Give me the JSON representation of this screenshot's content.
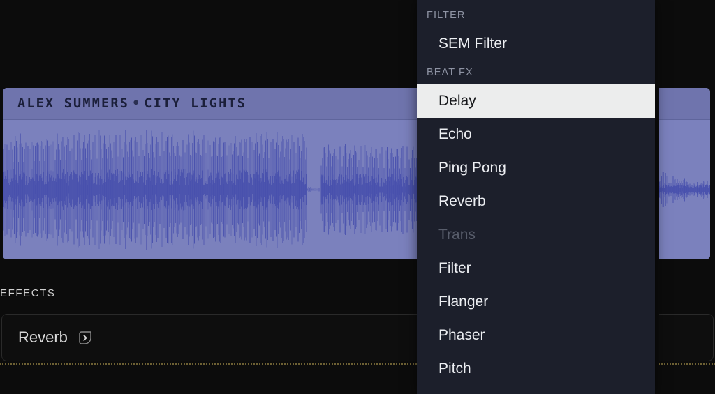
{
  "theme": {
    "page_bg": "#0c0c0c",
    "waveform_bg": "#7b81bd",
    "waveform_ink": "#4850ad",
    "track_header_bg": "#6f74ad",
    "menu_bg": "#1c1f2b",
    "menu_selected_bg": "#eceded",
    "menu_selected_text": "#16171a",
    "menu_label_text": "#8e93a3",
    "menu_disabled_text": "#585d6b",
    "divider_dotted": "#6d6033"
  },
  "track": {
    "artist": "ALEX SUMMERS",
    "separator": "•",
    "title": "CITY LIGHTS"
  },
  "effects": {
    "section_label": "EFFECTS",
    "items": [
      {
        "name": "Reverb",
        "expand_icon": "chevron-right-icon"
      }
    ]
  },
  "menu": {
    "sections": [
      {
        "label": "FILTER",
        "items": [
          {
            "label": "SEM Filter",
            "state": "normal"
          }
        ]
      },
      {
        "label": "BEAT FX",
        "items": [
          {
            "label": "Delay",
            "state": "selected"
          },
          {
            "label": "Echo",
            "state": "normal"
          },
          {
            "label": "Ping Pong",
            "state": "normal"
          },
          {
            "label": "Reverb",
            "state": "normal"
          },
          {
            "label": "Trans",
            "state": "disabled"
          },
          {
            "label": "Filter",
            "state": "normal"
          },
          {
            "label": "Flanger",
            "state": "normal"
          },
          {
            "label": "Phaser",
            "state": "normal"
          },
          {
            "label": "Pitch",
            "state": "normal"
          }
        ]
      }
    ]
  },
  "waveform": {
    "description": "stereo audio waveform, dense transient stripes",
    "segments": [
      {
        "start_pct": 0,
        "end_pct": 43,
        "amplitude": 0.92,
        "density": "high"
      },
      {
        "start_pct": 43,
        "end_pct": 45,
        "amplitude": 0.18,
        "density": "low"
      },
      {
        "start_pct": 45,
        "end_pct": 60,
        "amplitude": 0.72,
        "density": "high"
      },
      {
        "start_pct": 60,
        "end_pct": 91,
        "amplitude": 0.0,
        "density": "hidden"
      },
      {
        "start_pct": 91,
        "end_pct": 100,
        "amplitude": 0.42,
        "density": "medium"
      }
    ]
  }
}
